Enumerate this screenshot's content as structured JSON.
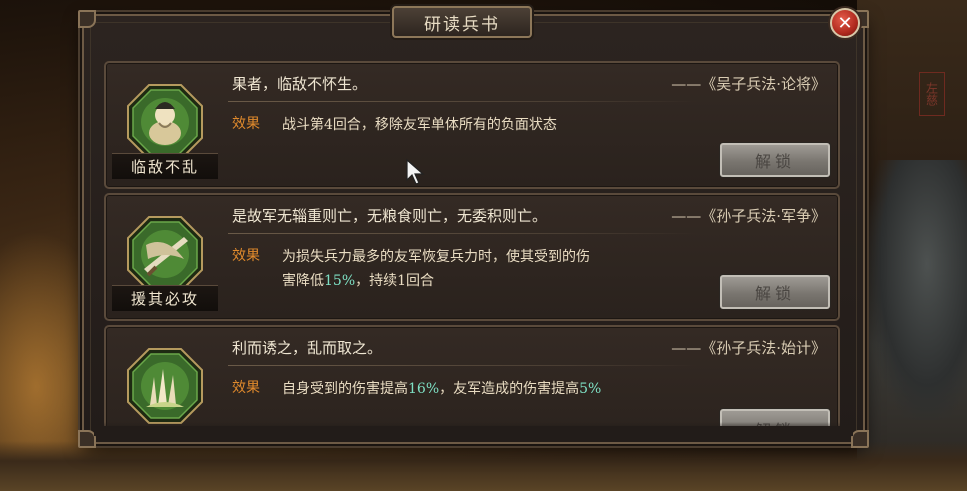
{
  "window": {
    "title": "研读兵书",
    "close_label": "✕"
  },
  "background": {
    "seal_text": "左慈"
  },
  "cards": [
    {
      "skill_name": "临敌不乱",
      "icon": "scholar-portrait-icon",
      "quote": "果者，临敌不怀生。",
      "source": "——《吴子兵法·论将》",
      "effect_label": "效果",
      "effect_parts": [
        "战斗第",
        "4",
        "回合，移除友军单体所有的负面状态"
      ],
      "button_label": "解锁"
    },
    {
      "skill_name": "援其必攻",
      "icon": "crossed-blades-icon",
      "quote": "是故军无辎重则亡，无粮食则亡，无委积则亡。",
      "source": "——《孙子兵法·军争》",
      "effect_label": "效果",
      "effect_line1": "为损失兵力最多的友军恢复兵力时，使其受到的伤",
      "effect_line2_parts": [
        "害降低",
        "15%",
        "，持续",
        "1",
        "回合"
      ],
      "button_label": "解锁"
    },
    {
      "skill_name": "",
      "icon": "grass-flame-icon",
      "quote": "利而诱之，乱而取之。",
      "source": "——《孙子兵法·始计》",
      "effect_label": "效果",
      "effect_parts": [
        "自身受到的伤害提高",
        "16%",
        "，友军造成的伤害提高",
        "5%"
      ],
      "button_label": "解锁"
    }
  ],
  "colors": {
    "effect_label": "#e08a2c",
    "highlight_value": "#7ee0c4",
    "close_button": "#b02a1e"
  }
}
